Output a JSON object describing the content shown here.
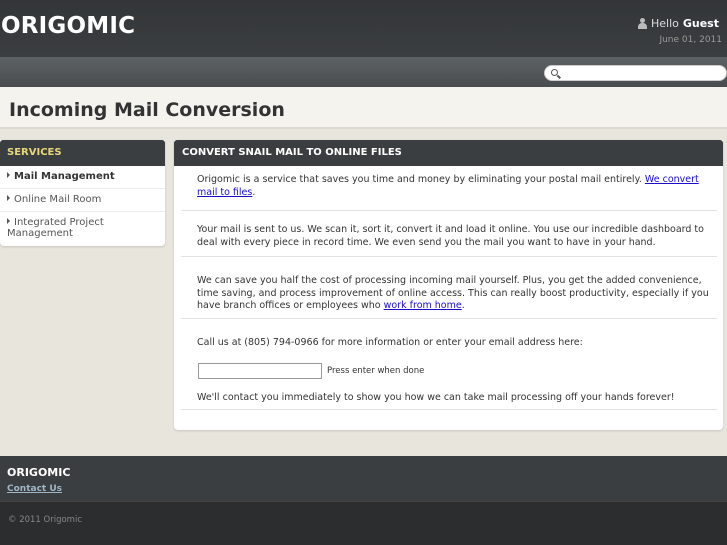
{
  "header": {
    "logo": "ORIGOMIC",
    "greeting": "Hello",
    "user": "Guest",
    "date": "June 01, 2011"
  },
  "search": {
    "placeholder": ""
  },
  "page": {
    "title": "Incoming Mail Conversion"
  },
  "sidebar": {
    "heading": "SERVICES",
    "items": [
      {
        "label": "Mail Management"
      },
      {
        "label": "Online Mail Room"
      },
      {
        "label": "Integrated Project Management"
      }
    ]
  },
  "main": {
    "heading": "CONVERT SNAIL MAIL TO ONLINE FILES",
    "p1_text": "Origomic is a service that saves you time and money by eliminating your postal mail entirely. ",
    "p1_link": "We convert mail to files",
    "p1_end": ".",
    "p2_text": "Your mail is sent to us. We scan it, sort it, convert it and load it online. You use our incredible dashboard to deal with every piece in record time. We even send you the mail you want to have in your hand.",
    "p3_text": "We can save you half the cost of processing incoming mail yourself. Plus, you get the added convenience, time saving, and process improvement of online access. This can really boost productivity, especially if you have branch offices or employees who ",
    "p3_link": "work from home",
    "p3_end": ".",
    "p4_text": "Call us at (805) 794-0966 for more information or enter your email address here:",
    "email_value": "",
    "hint": "Press enter when done",
    "p5_text": "We'll contact you immediately to show you how we can take mail processing off your hands forever!"
  },
  "footer": {
    "brand": "ORIGOMIC",
    "contact_link": "Contact Us",
    "copyright": "© 2011 Origomic"
  }
}
